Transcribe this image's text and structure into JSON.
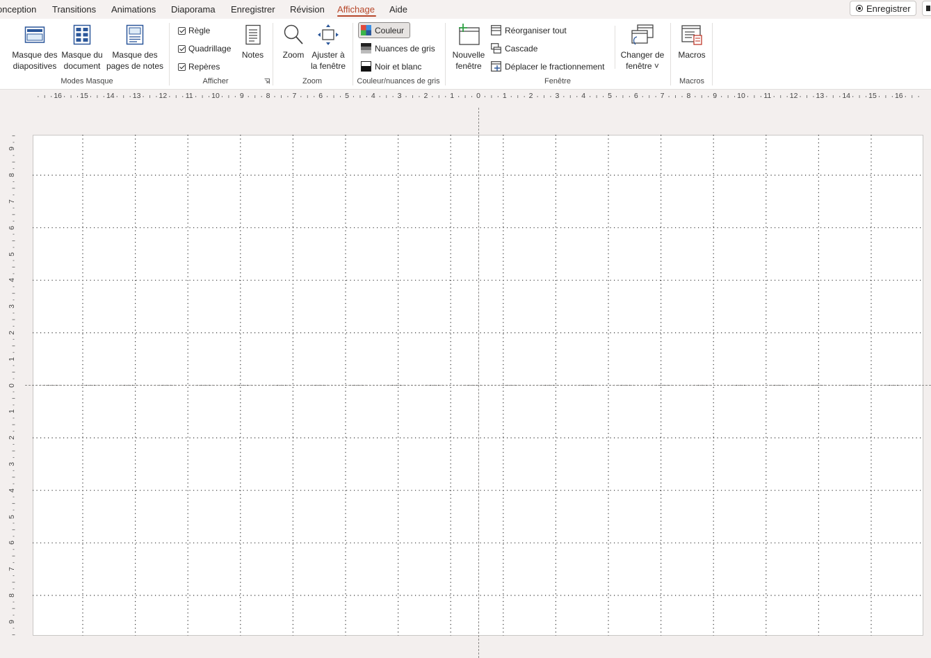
{
  "tabs": [
    {
      "label": "onception",
      "active": false
    },
    {
      "label": "Transitions",
      "active": false
    },
    {
      "label": "Animations",
      "active": false
    },
    {
      "label": "Diaporama",
      "active": false
    },
    {
      "label": "Enregistrer",
      "active": false
    },
    {
      "label": "Révision",
      "active": false
    },
    {
      "label": "Affichage",
      "active": true
    },
    {
      "label": "Aide",
      "active": false
    }
  ],
  "topbar": {
    "record_label": "Enregistrer"
  },
  "ribbon": {
    "modes_masque": {
      "label": "Modes Masque",
      "buttons": [
        {
          "label": "Masque des\ndiapositives",
          "icon": "slide-master-icon"
        },
        {
          "label": "Masque du\ndocument",
          "icon": "handout-master-icon"
        },
        {
          "label": "Masque des\npages de notes",
          "icon": "notes-master-icon"
        }
      ]
    },
    "afficher": {
      "label": "Afficher",
      "checkboxes": [
        {
          "label": "Règle",
          "checked": true
        },
        {
          "label": "Quadrillage",
          "checked": true
        },
        {
          "label": "Repères",
          "checked": true
        }
      ],
      "notes_label": "Notes"
    },
    "zoom": {
      "label": "Zoom",
      "zoom_label": "Zoom",
      "fit_label": "Ajuster à\nla fenêtre"
    },
    "couleur": {
      "label": "Couleur/nuances de gris",
      "options": [
        {
          "label": "Couleur",
          "selected": true
        },
        {
          "label": "Nuances de gris",
          "selected": false
        },
        {
          "label": "Noir et blanc",
          "selected": false
        }
      ]
    },
    "fenetre": {
      "label": "Fenêtre",
      "new_window_label": "Nouvelle\nfenêtre",
      "items": [
        "Réorganiser tout",
        "Cascade",
        "Déplacer le fractionnement"
      ],
      "switch_label": "Changer de\nfenêtre ˅"
    },
    "macros": {
      "label": "Macros",
      "button_label": "Macros"
    }
  },
  "ruler": {
    "horizontal": [
      "16",
      "15",
      "14",
      "13",
      "12",
      "11",
      "10",
      "9",
      "8",
      "7",
      "6",
      "5",
      "4",
      "3",
      "2",
      "1",
      "0",
      "1",
      "2",
      "3",
      "4",
      "5",
      "6",
      "7",
      "8",
      "9",
      "10",
      "11",
      "12",
      "13",
      "14",
      "15",
      "16"
    ],
    "vertical": [
      "9",
      "8",
      "7",
      "6",
      "5",
      "4",
      "3",
      "2",
      "1",
      "0",
      "1",
      "2",
      "3",
      "4",
      "5",
      "6",
      "7",
      "8",
      "9"
    ]
  }
}
